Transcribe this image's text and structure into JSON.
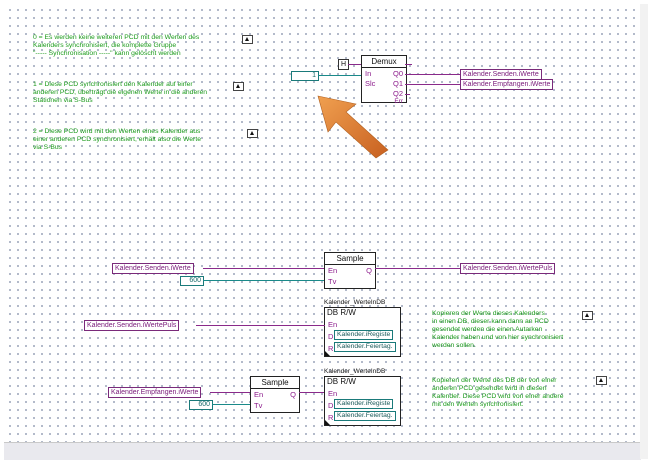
{
  "comments": {
    "c0": [
      "0 = Es werden keine weiteren PCD mit den Werten des",
      "Kalenders synchronisiert, die komplette Gruppe",
      "\"----- Synchronisation -----\" kann gelöscht werden"
    ],
    "c1": [
      "1 = Diese PCD synchronisiert den Kalender auf einer",
      "anderen PCD, überträgt die eigenen Werte in die anderen",
      "Stationen via S-Bus"
    ],
    "c2": [
      "2 = Diese PCD wird mit den Werten eines Kalender aus",
      "einer anderen PCD synchronisiert, erhält also die Werte",
      "via S-Bus"
    ],
    "c3": [
      "Kopieren der Werte dieses Kalenders",
      "in einen DB, dieser kann dann an PCD",
      "gesendet werden die einen Autarken",
      "Kalender haben und von hier synchronisiert",
      "werden sollen."
    ],
    "c4": [
      "Kopieren der Werte des DB der von einer",
      "anderen PCD gesendet wird in diesen",
      "Kalender. Diese PCD wird von einer andere",
      "mit den Werten synchronisiert."
    ]
  },
  "demux": {
    "title": "Demux",
    "in_ports": [
      "In",
      "Slc"
    ],
    "out_ports": [
      "Q0",
      "Q1",
      "Q2",
      "Err"
    ],
    "in_literal": "H",
    "slc_value": "1",
    "q1_label": "Kalender.Senden.iWerte",
    "q2_label": "Kalender.Empfangen.iWerte"
  },
  "sample1": {
    "title": "Sample",
    "ports": {
      "en": "En",
      "tv": "Tv",
      "q": "Q"
    },
    "in_label": "Kalender.Senden.iWerte",
    "tv_value": "600",
    "out_label": "Kalender.Senden.iWertePuls"
  },
  "db1": {
    "tag": "Kalender_WerteInDB",
    "title": "DB R/W",
    "ports": {
      "en": "En",
      "d": "D",
      "r": "R"
    },
    "in_label": "Kalender.Senden.iWertePuls",
    "d_label": "Kalender.iRegiste",
    "r_label": "Kalender.Feiertag."
  },
  "sample2": {
    "title": "Sample",
    "ports": {
      "en": "En",
      "tv": "Tv",
      "q": "Q"
    },
    "in_label": "Kalender.Empfangen.iWerte",
    "tv_value": "600"
  },
  "db2": {
    "tag": "Kalender_WerteInDB",
    "title": "DB R/W",
    "ports": {
      "en": "En",
      "d": "D",
      "r": "R"
    },
    "d_label": "Kalender.iRegiste",
    "r_label": "Kalender.Feiertag."
  },
  "arrow_color": "#e0893a",
  "wire_colors": {
    "bool": "#8a2a8a",
    "int": "#1a8a8a"
  }
}
